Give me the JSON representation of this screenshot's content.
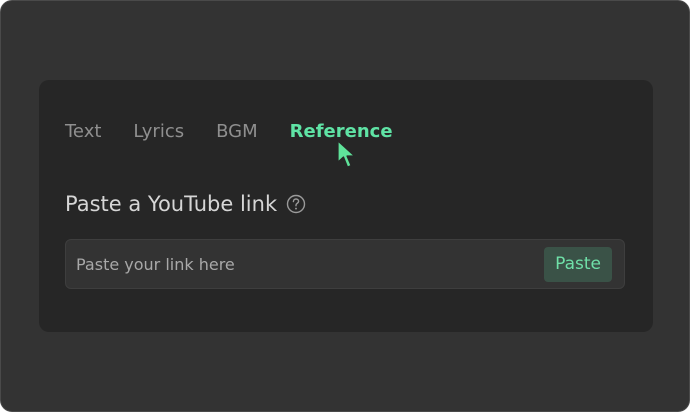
{
  "tabs": [
    {
      "label": "Text",
      "active": false
    },
    {
      "label": "Lyrics",
      "active": false
    },
    {
      "label": "BGM",
      "active": false
    },
    {
      "label": "Reference",
      "active": true
    }
  ],
  "section": {
    "title": "Paste a YouTube link",
    "help_icon": "question-circle-icon"
  },
  "link_input": {
    "value": "",
    "placeholder": "Paste your link here"
  },
  "paste_button": {
    "label": "Paste"
  },
  "colors": {
    "window_bg": "#333333",
    "panel_bg": "#262626",
    "accent_green": "#5fe3a5",
    "tab_inactive": "#8f8f8f",
    "title_text": "#d6d6d6",
    "button_bg": "#3a5247",
    "button_text": "#6fe0a8"
  }
}
